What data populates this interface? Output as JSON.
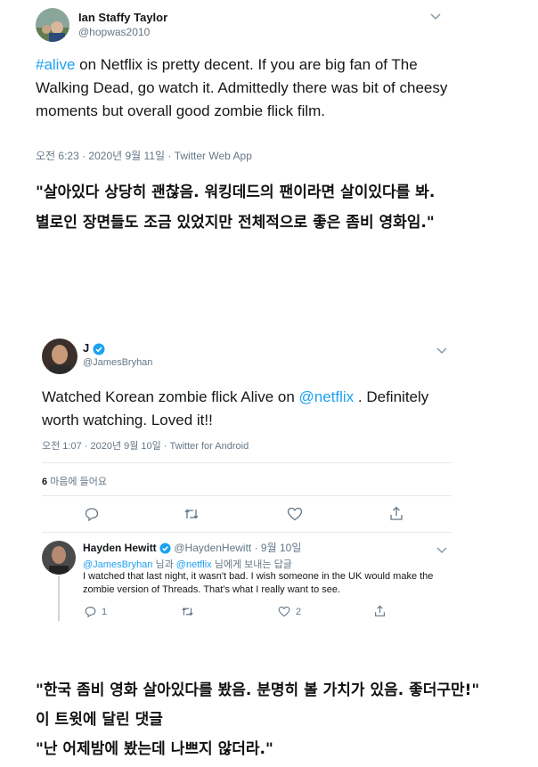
{
  "tweet1": {
    "name": "Ian Staffy Taylor",
    "handle": "@hopwas2010",
    "hashtag": "#alive",
    "text_rest": " on Netflix is pretty decent. If you are big fan of The Walking Dead, go watch it. Admittedly there was bit of cheesy moments but overall good zombie flick film.",
    "meta": "오전 6:23 · 2020년 9월 11일 · Twitter Web App"
  },
  "caption1": {
    "line1": "\"살아있다 상당히 괜찮음. 워킹데드의 팬이라면 살이있다를 봐.",
    "line2": "별로인 장면들도 조금 있었지만 전체적으로 좋은 좀비 영화임.\""
  },
  "tweet2": {
    "name": "J",
    "handle": "@JamesBryhan",
    "text_before": "Watched Korean zombie flick Alive on ",
    "mention": "@netflix",
    "text_after": " . Definitely worth watching. Loved it!!",
    "meta": "오전 1:07 · 2020년 9월 10일 · Twitter for Android",
    "likes_count": "6",
    "likes_label": "마음에 들어요"
  },
  "reply": {
    "name": "Hayden Hewitt",
    "handle_time": "@HaydenHewitt · 9월 10일",
    "reply_to_user1": "@JamesBryhan",
    "reply_to_and": " 님과 ",
    "reply_to_user2": "@netflix",
    "reply_to_suffix": " 님에게 보내는 답글",
    "text": "I watched that last night, it wasn't bad. I wish someone in the UK would make the zombie version of Threads. That's what I really want to see.",
    "reply_count": "1",
    "like_count": "2"
  },
  "caption2": {
    "line1": "\"한국 좀비 영화 살아있다를 봤음. 분명히 볼 가치가 있음. 좋더구만!\"",
    "line2": "이 트윗에 달린 댓글",
    "line3": "\"난 어제밤에 봤는데 나쁘지 않더라.\""
  },
  "colors": {
    "link": "#1da1f2",
    "muted": "#657786",
    "divider": "#e1e8ed"
  },
  "icons": [
    "chevron-down-icon",
    "verified-badge-icon",
    "reply-icon",
    "retweet-icon",
    "like-icon",
    "share-icon"
  ]
}
